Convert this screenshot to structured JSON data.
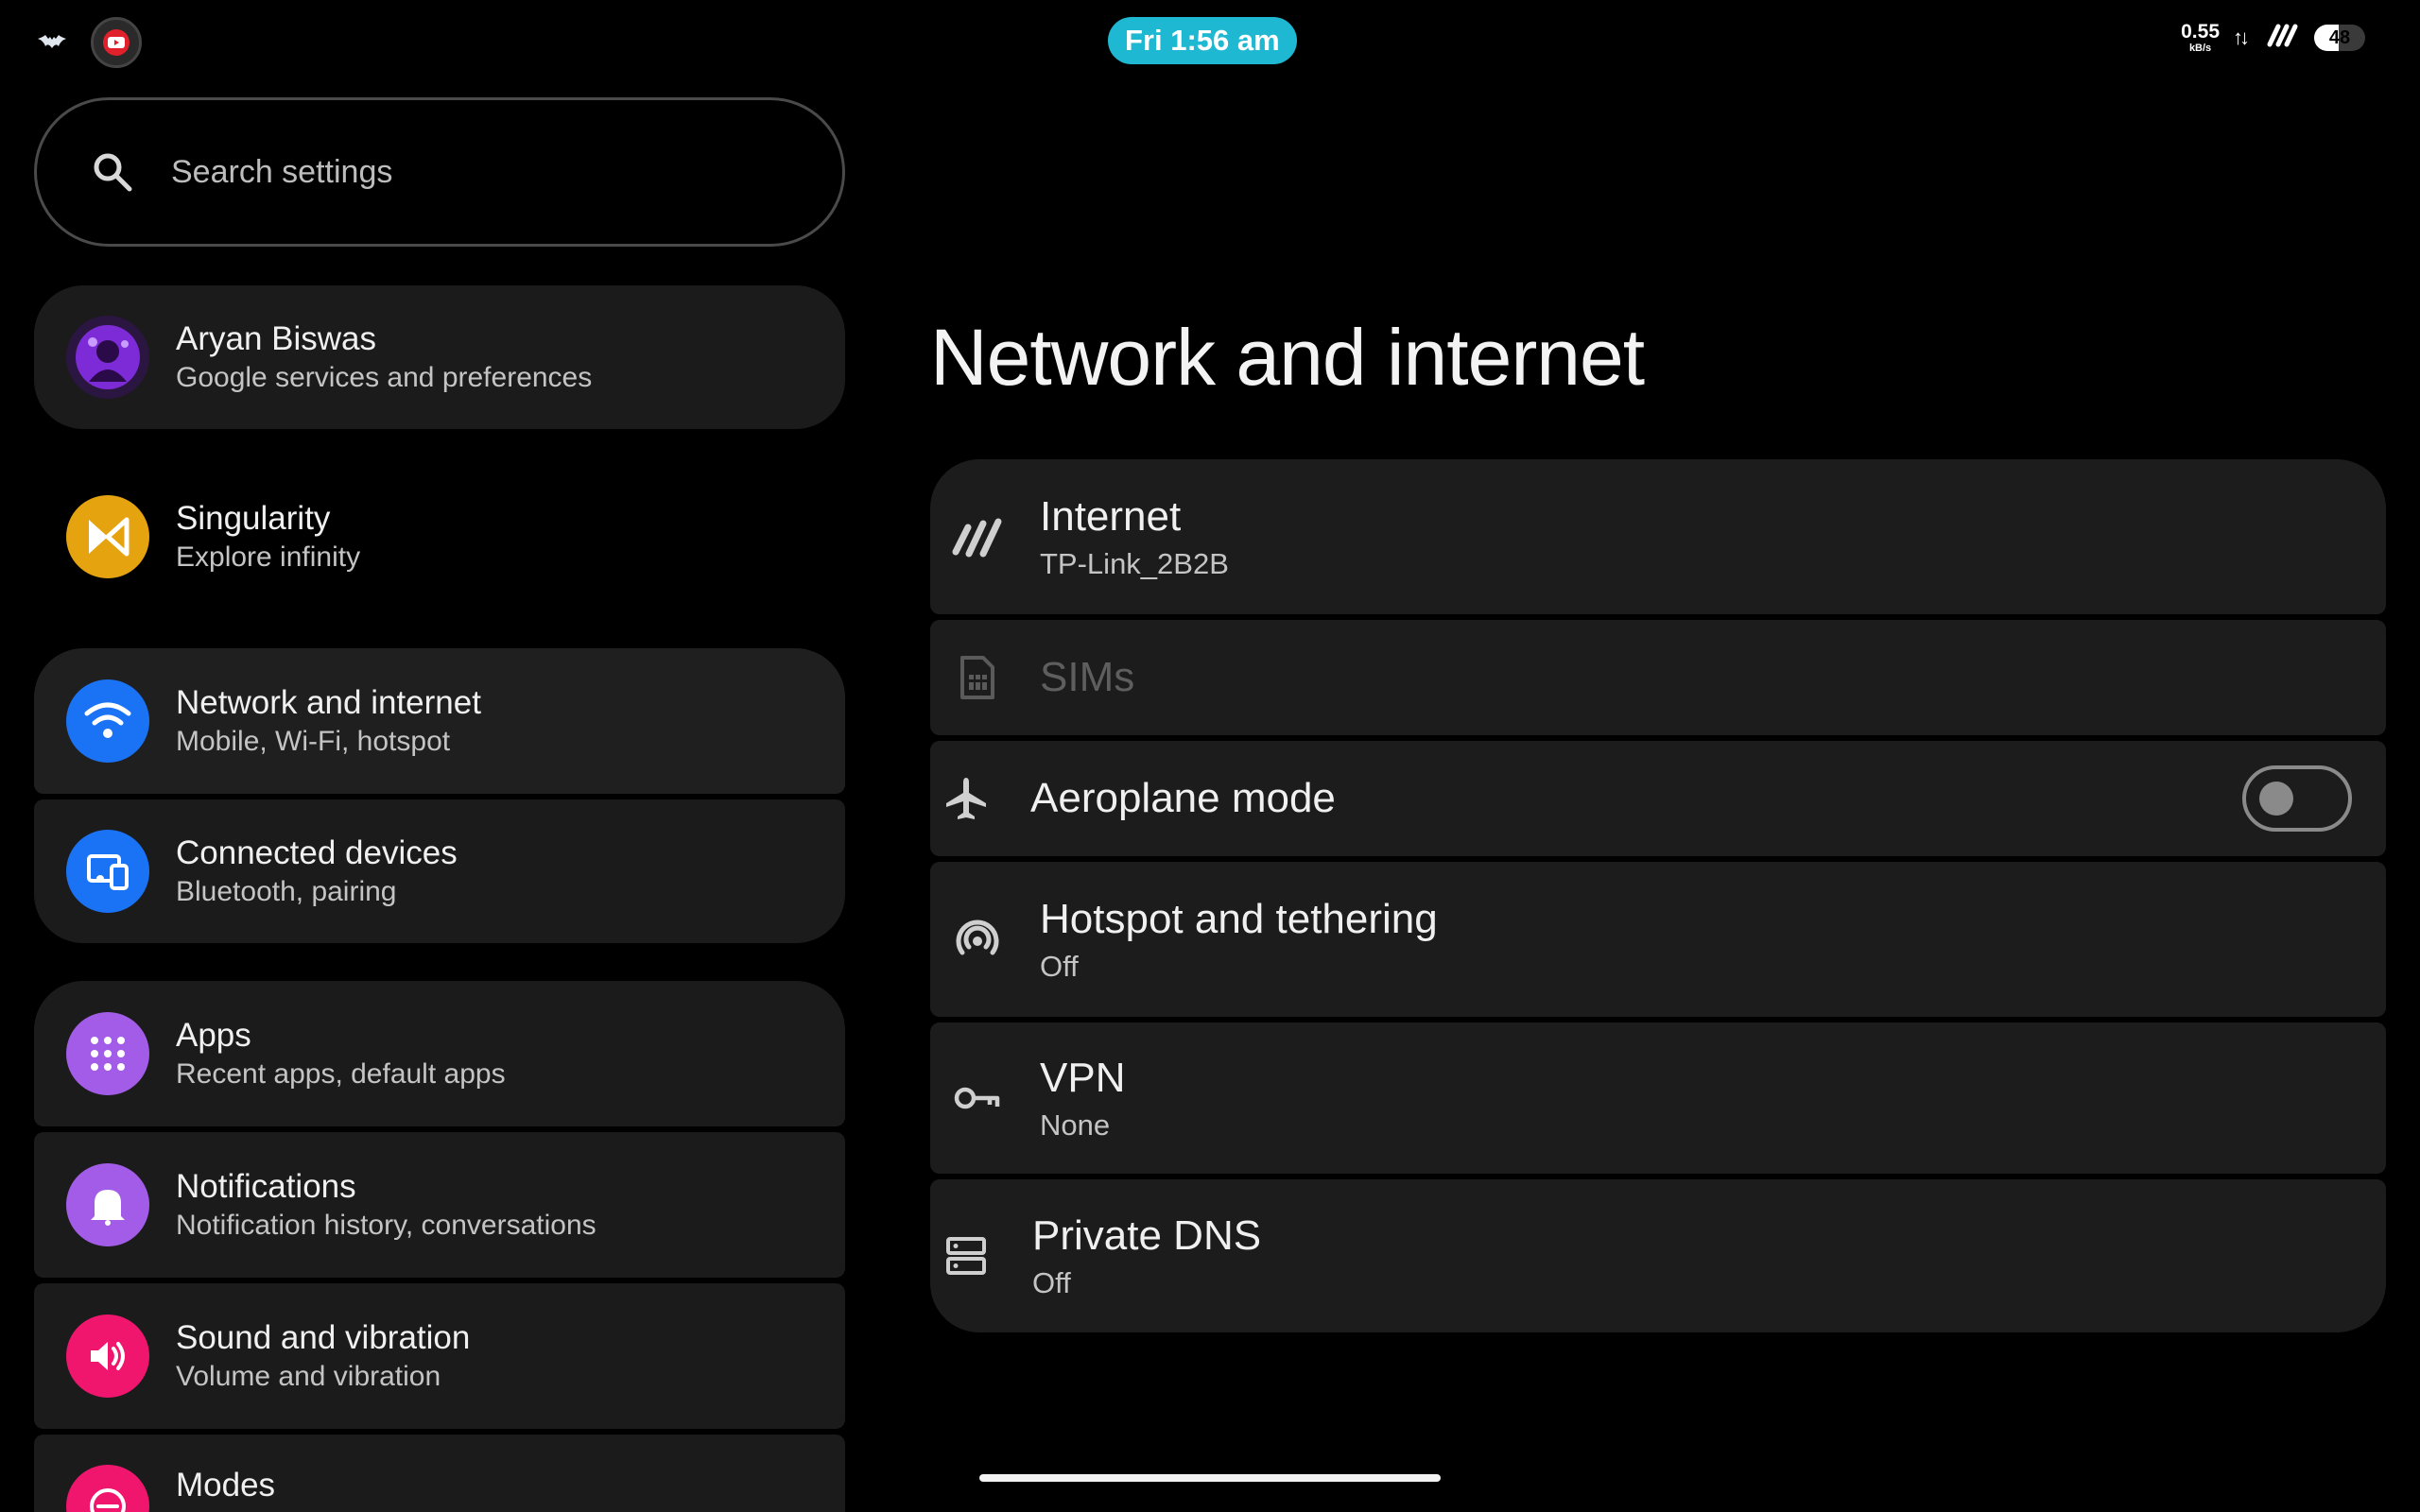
{
  "status_bar": {
    "time": "Fri 1:56 am",
    "net_speed_value": "0.55",
    "net_speed_unit": "kB/s",
    "battery_level": "48",
    "icons": [
      "bat-logo-icon",
      "youtube-icon",
      "upload-download-arrows-icon",
      "wifi-icon",
      "battery-icon"
    ]
  },
  "search": {
    "placeholder": "Search settings"
  },
  "sidebar": {
    "items": [
      {
        "title": "Aryan Biswas",
        "subtitle": "Google services and preferences",
        "icon": "profile-avatar"
      },
      {
        "title": "Singularity",
        "subtitle": "Explore infinity",
        "icon": "singularity-icon",
        "color": "#e5a30f"
      },
      {
        "title": "Network and internet",
        "subtitle": "Mobile, Wi-Fi, hotspot",
        "icon": "wifi-icon",
        "color": "#1a73f5"
      },
      {
        "title": "Connected devices",
        "subtitle": "Bluetooth, pairing",
        "icon": "devices-icon",
        "color": "#1a73f5"
      },
      {
        "title": "Apps",
        "subtitle": "Recent apps, default apps",
        "icon": "apps-grid-icon",
        "color": "#a35ce8"
      },
      {
        "title": "Notifications",
        "subtitle": "Notification history, conversations",
        "icon": "bell-icon",
        "color": "#a35ce8"
      },
      {
        "title": "Sound and vibration",
        "subtitle": "Volume and vibration",
        "icon": "speaker-icon",
        "color": "#f0166e"
      },
      {
        "title": "Modes",
        "subtitle": "",
        "icon": "modes-icon",
        "color": "#f0166e"
      }
    ]
  },
  "main": {
    "title": "Network and internet",
    "rows": [
      {
        "title": "Internet",
        "subtitle": "TP-Link_2B2B",
        "icon": "wifi-slash-icon"
      },
      {
        "title": "SIMs",
        "subtitle": "",
        "icon": "sim-card-icon",
        "disabled": true
      },
      {
        "title": "Aeroplane mode",
        "subtitle": "",
        "icon": "airplane-icon",
        "toggle": false
      },
      {
        "title": "Hotspot and tethering",
        "subtitle": "Off",
        "icon": "hotspot-icon"
      },
      {
        "title": "VPN",
        "subtitle": "None",
        "icon": "key-icon"
      },
      {
        "title": "Private DNS",
        "subtitle": "Off",
        "icon": "dns-server-icon"
      }
    ]
  },
  "colors": {
    "background": "#000000",
    "card": "#1b1b1b",
    "time_pill": "#1fb8d2"
  }
}
